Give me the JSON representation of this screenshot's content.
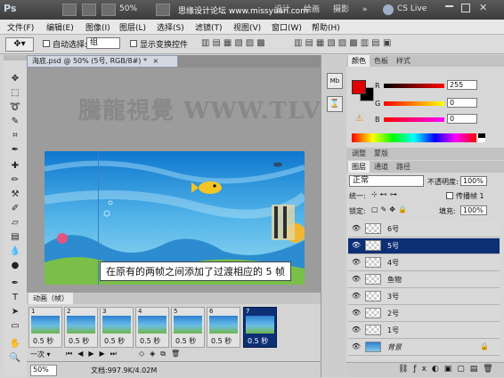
{
  "titlebar": {
    "app_logo": "Ps",
    "zoom": "50%",
    "watermark_text": "思缘设计论坛  www.missyuan.com",
    "workspaces": [
      "设计",
      "绘画",
      "摄影"
    ],
    "cs_live": "CS Live",
    "more_button": "»"
  },
  "menu": [
    "文件(F)",
    "编辑(E)",
    "图像(I)",
    "图层(L)",
    "选择(S)",
    "滤镜(T)",
    "视图(V)",
    "窗口(W)",
    "帮助(H)"
  ],
  "options": {
    "auto_select_label": "自动选择:",
    "auto_select_value": "组",
    "show_transform_label": "显示变换控件"
  },
  "document": {
    "tab_label": "海底.psd @ 50% (5号, RGB/8#) *",
    "close_symbol": "×",
    "watermark": "騰龍視覺 WWW.TLVIS",
    "caption": "在原有的两帧之间添加了过渡相应的 5 帧"
  },
  "animation": {
    "title": "动画（帧）",
    "frames": [
      {
        "num": "1",
        "duration": "0.5 秒"
      },
      {
        "num": "2",
        "duration": "0.5 秒"
      },
      {
        "num": "3",
        "duration": "0.5 秒"
      },
      {
        "num": "4",
        "duration": "0.5 秒"
      },
      {
        "num": "5",
        "duration": "0.5 秒"
      },
      {
        "num": "6",
        "duration": "0.5 秒"
      },
      {
        "num": "7",
        "duration": "0.5 秒"
      }
    ],
    "selected_frame": 7,
    "loop_value": "一次"
  },
  "status": {
    "zoom": "50%",
    "doc_info": "文档:997.9K/4.02M"
  },
  "color_panel": {
    "tabs": [
      "颜色",
      "色板",
      "样式"
    ],
    "r_label": "R",
    "g_label": "G",
    "b_label": "B",
    "r_value": "255",
    "g_value": "0",
    "b_value": "0",
    "foreground": "#e00000",
    "background": "#000000"
  },
  "adjust_panel": {
    "tabs": [
      "调整",
      "蒙版"
    ]
  },
  "layers_panel": {
    "tabs": [
      "图层",
      "通道",
      "路径"
    ],
    "blend_mode": "正常",
    "opacity_label": "不透明度:",
    "opacity_value": "100%",
    "unify_label": "统一:",
    "propagate_label": "传播帧 1",
    "lock_label": "锁定:",
    "fill_label": "填充:",
    "fill_value": "100%",
    "layers": [
      {
        "name": "6号",
        "selected": false
      },
      {
        "name": "5号",
        "selected": true
      },
      {
        "name": "4号",
        "selected": false
      },
      {
        "name": "鱼物",
        "selected": false
      },
      {
        "name": "3号",
        "selected": false
      },
      {
        "name": "2号",
        "selected": false
      },
      {
        "name": "1号",
        "selected": false
      },
      {
        "name": "背景",
        "selected": false
      }
    ]
  }
}
